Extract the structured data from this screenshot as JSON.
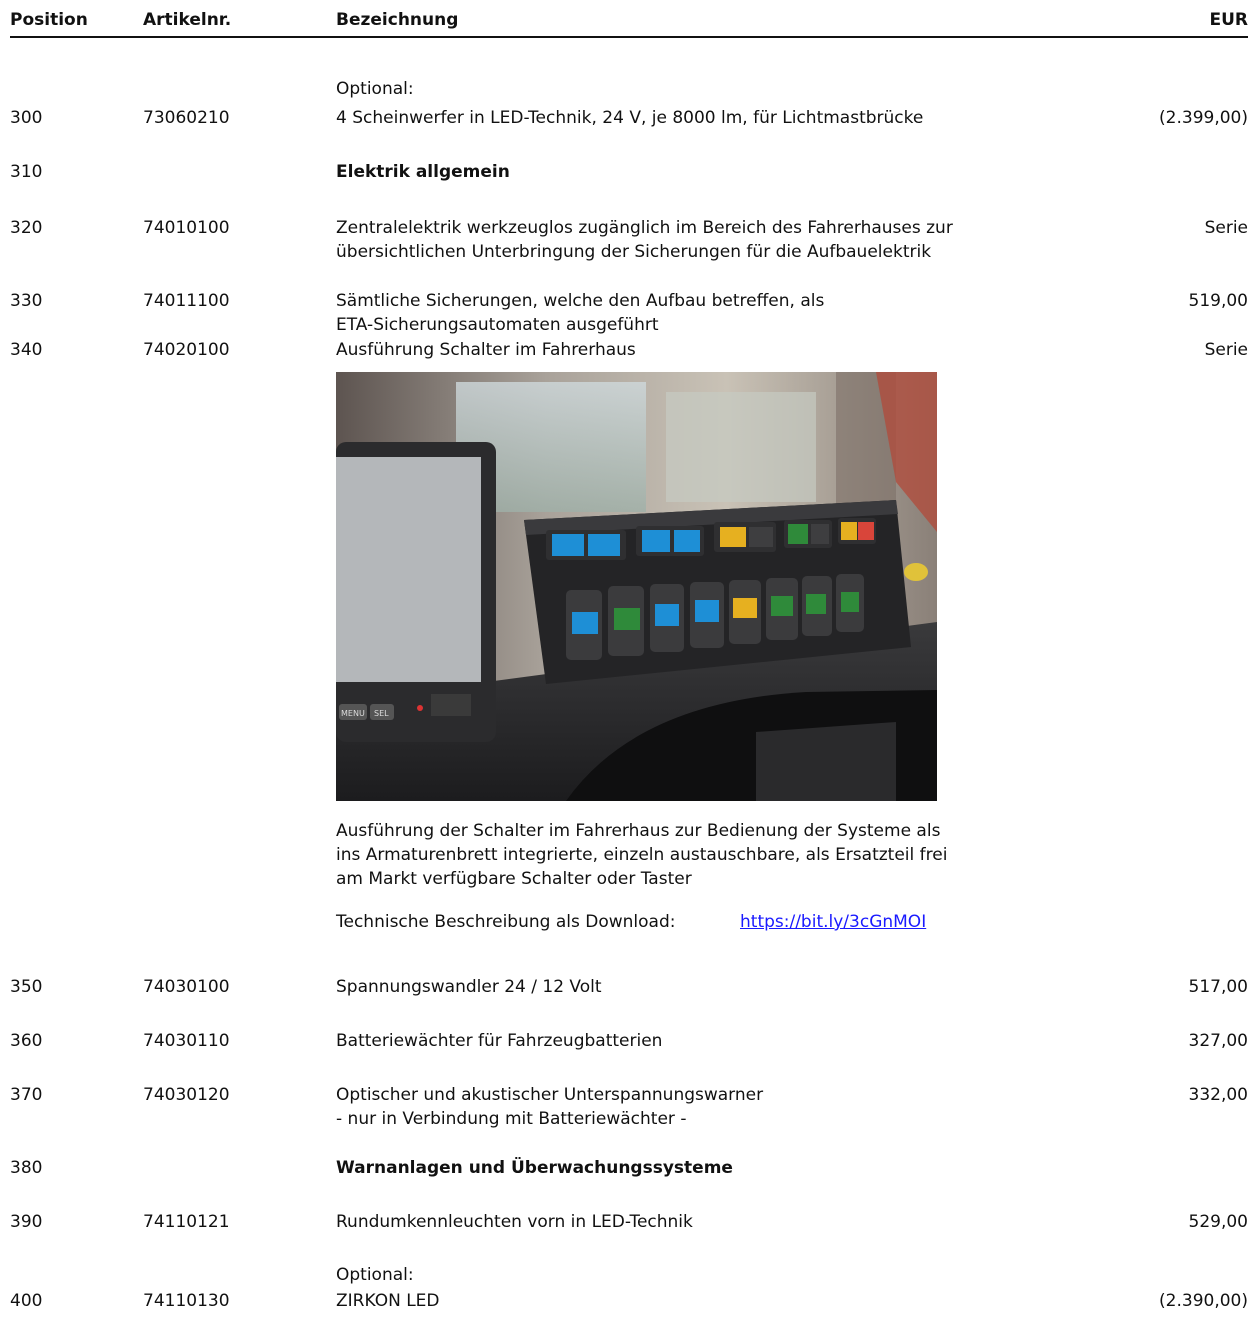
{
  "header": {
    "position": "Position",
    "artikelnr": "Artikelnr.",
    "bezeichnung": "Bezeichnung",
    "eur": "EUR"
  },
  "rows": {
    "r300": {
      "optional": "Optional:",
      "pos": "300",
      "art": "73060210",
      "text": "4 Scheinwerfer in LED-Technik, 24 V, je 8000 lm, für Lichtmastbrücke",
      "price": "(2.399,00)"
    },
    "r310": {
      "pos": "310",
      "text": "Elektrik allgemein"
    },
    "r320": {
      "pos": "320",
      "art": "74010100",
      "line1": "Zentralelektrik werkzeuglos zugänglich im Bereich des Fahrerhauses zur",
      "line2": "übersichtlichen Unterbringung der Sicherungen für die Aufbauelektrik",
      "price": "Serie"
    },
    "r330": {
      "pos": "330",
      "art": "74011100",
      "line1": "Sämtliche Sicherungen, welche den Aufbau betreffen, als",
      "line2": "ETA-Sicherungsautomaten ausgeführt",
      "price": "519,00"
    },
    "r340": {
      "pos": "340",
      "art": "74020100",
      "text": "Ausführung Schalter im Fahrerhaus",
      "price": "Serie",
      "desc1": "Ausführung der Schalter im Fahrerhaus zur Bedienung der Systeme als",
      "desc2": "ins Armaturenbrett integrierte, einzeln austauschbare, als Ersatzteil frei",
      "desc3": "am Markt verfügbare Schalter oder Taster",
      "download_label": "Technische Beschreibung als Download:",
      "download_link": "https://bit.ly/3cGnMOI",
      "photo": {
        "button_menu": "MENU",
        "button_sel": "SEL"
      }
    },
    "r350": {
      "pos": "350",
      "art": "74030100",
      "text": "Spannungswandler 24 / 12 Volt",
      "price": "517,00"
    },
    "r360": {
      "pos": "360",
      "art": "74030110",
      "text": "Batteriewächter für Fahrzeugbatterien",
      "price": "327,00"
    },
    "r370": {
      "pos": "370",
      "art": "74030120",
      "line1": "Optischer und akustischer Unterspannungswarner",
      "line2": "- nur in Verbindung mit Batteriewächter -",
      "price": "332,00"
    },
    "r380": {
      "pos": "380",
      "text": "Warnanlagen und Überwachungssysteme"
    },
    "r390": {
      "pos": "390",
      "art": "74110121",
      "text": "Rundumkennleuchten vorn in LED-Technik",
      "price": "529,00"
    },
    "r400": {
      "optional": "Optional:",
      "pos": "400",
      "art": "74110130",
      "text": "ZIRKON LED",
      "price": "(2.390,00)"
    }
  },
  "colors": {
    "text": "#111111",
    "link": "#1a1aff",
    "switch_blue": "#1e8fd6",
    "switch_green": "#2f8a3a",
    "switch_yellow": "#e6b020"
  }
}
